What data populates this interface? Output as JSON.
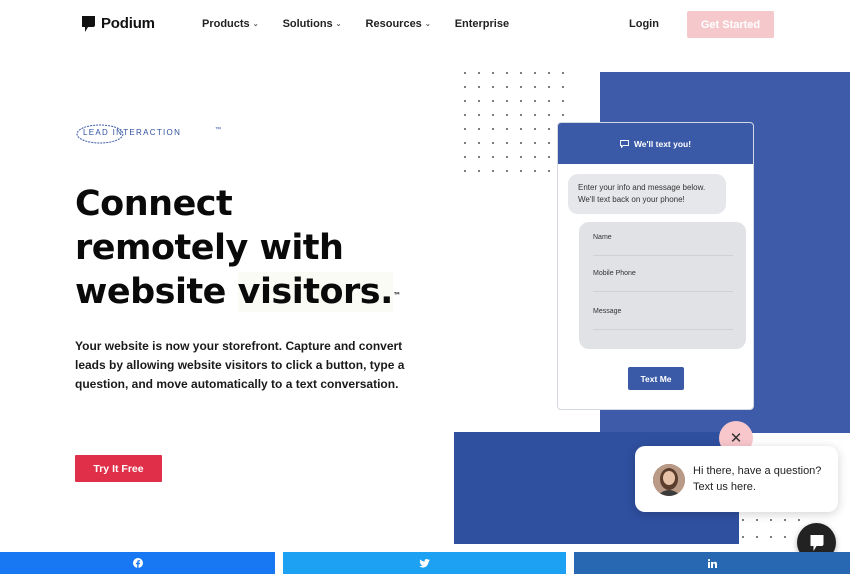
{
  "brand": {
    "name": "Podium"
  },
  "nav": {
    "items": [
      {
        "label": "Products",
        "has_menu": true
      },
      {
        "label": "Solutions",
        "has_menu": true
      },
      {
        "label": "Resources",
        "has_menu": true
      },
      {
        "label": "Enterprise",
        "has_menu": false
      }
    ],
    "login_label": "Login",
    "get_started_label": "Get Started"
  },
  "hero": {
    "badge_text": "LEAD INTERACTION",
    "badge_tm": "™",
    "headline_line1": "Connect",
    "headline_line2": "remotely with",
    "headline_line3a": "website",
    "headline_line3b": "visitors.",
    "headline_tm": "™",
    "description": "Your website is now your storefront. Capture and convert leads by allowing website visitors to click a button, type a question, and move automatically to a text conversation.",
    "cta_label": "Try It Free"
  },
  "widget": {
    "header": "We'll text you!",
    "intro": "Enter your info and message below. We'll text back on your phone!",
    "fields": [
      "Name",
      "Mobile Phone",
      "Message"
    ],
    "submit_label": "Text Me"
  },
  "chat_popup": {
    "message": "Hi there, have a question? Text us here."
  },
  "share_bar": {
    "networks": [
      "facebook",
      "twitter",
      "linkedin"
    ]
  },
  "colors": {
    "accent_red": "#e03049",
    "brand_blue": "#3a5aa8",
    "get_started_bg": "#f5c9cc",
    "facebook": "#1877f2",
    "twitter": "#1da1f2",
    "linkedin": "#2867b2"
  }
}
